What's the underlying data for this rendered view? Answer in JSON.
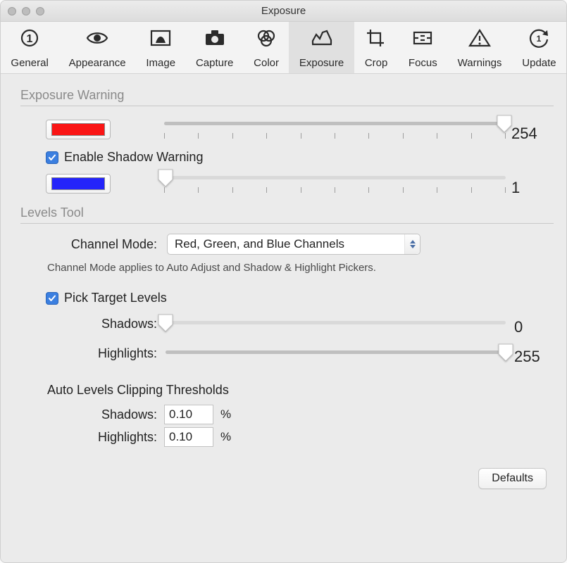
{
  "window": {
    "title": "Exposure"
  },
  "tabs": [
    {
      "id": "general",
      "label": "General"
    },
    {
      "id": "appearance",
      "label": "Appearance"
    },
    {
      "id": "image",
      "label": "Image"
    },
    {
      "id": "capture",
      "label": "Capture"
    },
    {
      "id": "color",
      "label": "Color"
    },
    {
      "id": "exposure",
      "label": "Exposure",
      "selected": true
    },
    {
      "id": "crop",
      "label": "Crop"
    },
    {
      "id": "focus",
      "label": "Focus"
    },
    {
      "id": "warnings",
      "label": "Warnings"
    },
    {
      "id": "update",
      "label": "Update"
    }
  ],
  "sections": {
    "exposureWarning": {
      "title": "Exposure Warning",
      "highlight": {
        "swatch": "#fa1616",
        "value": 254,
        "min": 0,
        "max": 255
      },
      "enableShadowLabel": "Enable Shadow Warning",
      "enableShadowChecked": true,
      "shadow": {
        "swatch": "#2424fa",
        "value": 1,
        "min": 0,
        "max": 255
      }
    },
    "levels": {
      "title": "Levels Tool",
      "channelModeLabel": "Channel Mode:",
      "channelModeValue": "Red, Green, and Blue Channels",
      "channelModeHint": "Channel Mode applies to Auto Adjust and Shadow & Highlight Pickers.",
      "pickTargetLabel": "Pick Target Levels",
      "pickTargetChecked": true,
      "shadowsLabel": "Shadows:",
      "highlightsLabel": "Highlights:",
      "shadowsValue": 0,
      "highlightsValue": 255,
      "clipHeading": "Auto Levels Clipping Thresholds",
      "clipShadows": "0.10",
      "clipHighlights": "0.10",
      "percent": "%"
    }
  },
  "footer": {
    "defaults": "Defaults"
  }
}
